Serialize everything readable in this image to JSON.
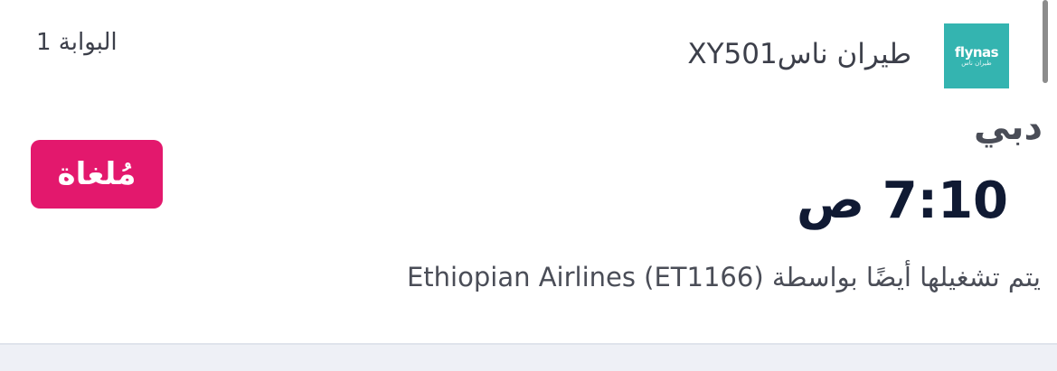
{
  "flight": {
    "airline_logo_text": "flynas",
    "airline_logo_subtext": "طيران ناس",
    "airline_name": "طيران ناس",
    "flight_number": "XY501",
    "gate": "البوابة 1",
    "destination": "دبي",
    "time": "7:10 ص",
    "status": "مُلغاة",
    "operated_by": "يتم تشغيلها أيضًا بواسطة Ethiopian Airlines (ET1166)"
  },
  "colors": {
    "logo_bg": "#34b4b0",
    "status_cancelled": "#e3186d",
    "time_text": "#101a33"
  }
}
